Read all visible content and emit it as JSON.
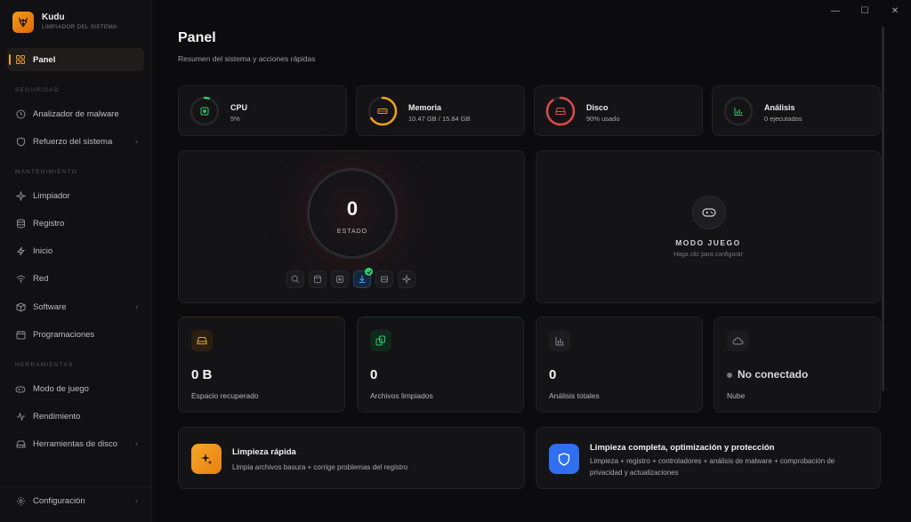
{
  "app": {
    "name": "Kudu",
    "subtitle": "LIMPIADOR DEL SISTEMA"
  },
  "window": {
    "minimize": "—",
    "maximize": "☐",
    "close": "✕"
  },
  "sidebar": {
    "active": "Panel",
    "sections": {
      "security": "SEGURIDAD",
      "maintenance": "MANTENIMIENTO",
      "tools": "HERRAMIENTAS"
    },
    "items": {
      "malware": "Analizador de malware",
      "hardening": "Refuerzo del sistema",
      "cleaner": "Limpiador",
      "registry": "Registro",
      "startup": "Inicio",
      "network": "Red",
      "software": "Software",
      "schedules": "Programaciones",
      "gamemode": "Modo de juego",
      "performance": "Rendimiento",
      "disktools": "Herramientas de disco",
      "settings": "Configuración"
    }
  },
  "page": {
    "title": "Panel",
    "subtitle": "Resumen del sistema y acciones rápidas"
  },
  "stats": {
    "cpu": {
      "label": "CPU",
      "value": "5%",
      "fraction": 0.05,
      "color": "#2ecc71"
    },
    "memory": {
      "label": "Memoria",
      "value": "10.47 GB / 15.84 GB",
      "fraction": 0.66,
      "color": "#f0a020"
    },
    "disk": {
      "label": "Disco",
      "value": "90% usado",
      "fraction": 0.9,
      "color": "#e04848"
    },
    "analysis": {
      "label": "Análisis",
      "value": "0 ejecutados",
      "fraction": 0,
      "color": "#2ecc71"
    }
  },
  "status": {
    "value": "0",
    "label": "ESTADO"
  },
  "gamemode": {
    "title": "MODO JUEGO",
    "subtitle": "Haga clic para configurar"
  },
  "tiles": {
    "space": {
      "value": "0 B",
      "label": "Espacio recuperado"
    },
    "files": {
      "value": "0",
      "label": "Archivos limpiados"
    },
    "scans": {
      "value": "0",
      "label": "Análisis totales"
    },
    "cloud": {
      "value": "No conectado",
      "label": "Nube"
    }
  },
  "actions": {
    "quick": {
      "title": "Limpieza rápida",
      "desc": "Limpia archivos basura + corrige problemas del registro"
    },
    "full": {
      "title": "Limpieza completa, optimización y protección",
      "desc1": "Limpieza + registro + controladores + análisis de malware + comprobación de",
      "desc2": "privacidad y actualizaciones"
    }
  },
  "colors": {
    "accent": "#f29b1f",
    "green": "#2ecc71",
    "blue": "#2f6ff0"
  }
}
